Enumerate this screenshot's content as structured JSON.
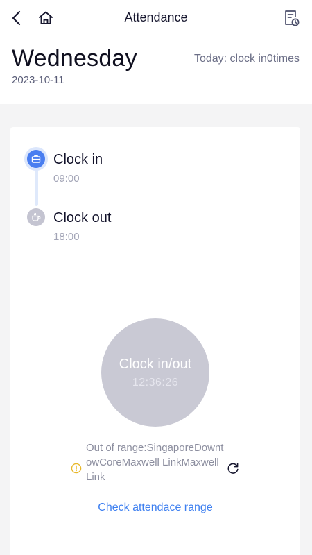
{
  "header": {
    "title": "Attendance",
    "back_icon": "chevron-left-icon",
    "home_icon": "home-icon",
    "history_icon": "document-clock-icon"
  },
  "day": {
    "weekday": "Wednesday",
    "date": "2023-10-11",
    "today_summary": "Today: clock in0times"
  },
  "timeline": [
    {
      "label": "Clock in",
      "time": "09:00",
      "icon": "briefcase-icon",
      "active": true
    },
    {
      "label": "Clock out",
      "time": "18:00",
      "icon": "coffee-cup-icon",
      "active": false
    }
  ],
  "clock_button": {
    "label": "Clock in/out",
    "time": "12:36:26"
  },
  "location": {
    "status_text": "Out of range:SingaporeDowntowCoreMaxwell LinkMaxwell Link",
    "warning_icon": "warning-circle-icon",
    "refresh_icon": "refresh-icon",
    "check_range_link": "Check attendace range"
  },
  "colors": {
    "accent": "#4a7ef0",
    "link": "#3d7ff0",
    "warning": "#e8b82a",
    "clock_button": "#c9c9d4",
    "background": "#f4f4f5"
  }
}
